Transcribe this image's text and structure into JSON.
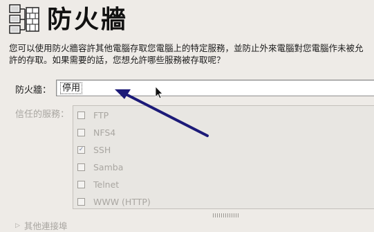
{
  "header": {
    "title": "防火牆",
    "icon": "firewall-network-icon"
  },
  "description": "您可以使用防火牆容許其他電腦存取您電腦上的特定服務，並防止外來電腦對您電腦作未被允許的存取。如果需要的話，您想允許哪些服務被存取呢？",
  "firewall": {
    "label": "防火牆：",
    "value": "停用"
  },
  "services": {
    "label": "信任的服務：",
    "items": [
      {
        "name": "FTP",
        "checked": false
      },
      {
        "name": "NFS4",
        "checked": false
      },
      {
        "name": "SSH",
        "checked": true
      },
      {
        "name": "Samba",
        "checked": false
      },
      {
        "name": "Telnet",
        "checked": false
      },
      {
        "name": "WWW (HTTP)",
        "checked": false
      }
    ]
  },
  "other_ports": {
    "label": "其他連接埠"
  },
  "annotation": {
    "color": "#1c1a78"
  }
}
